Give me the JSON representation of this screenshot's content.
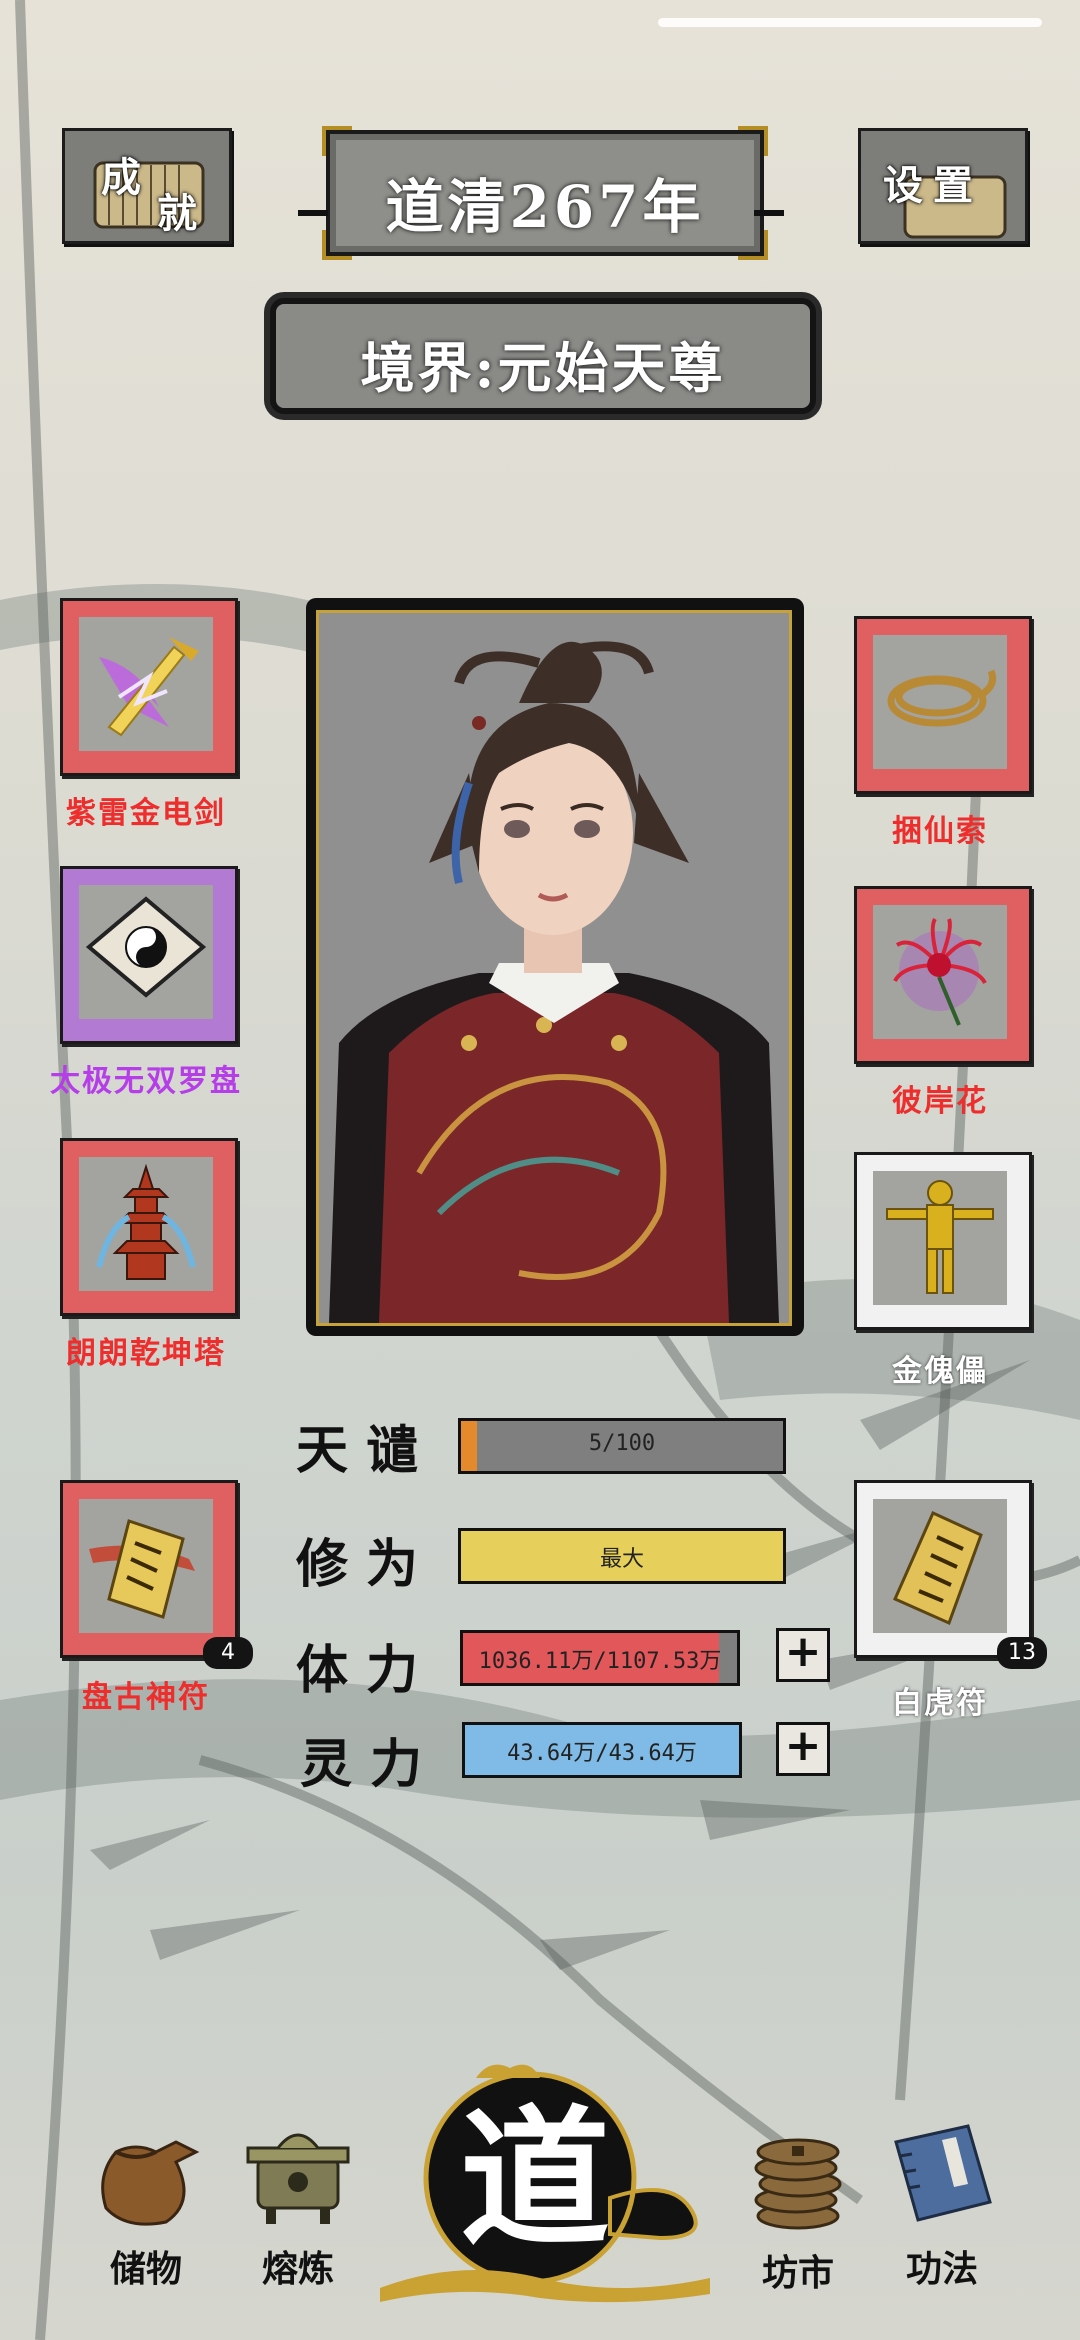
{
  "header": {
    "achievements_label": [
      "成",
      "就"
    ],
    "year_title": "道清267年",
    "settings_label": "设置",
    "realm": "境界:元始天尊"
  },
  "left_items": [
    {
      "name": "紫雷金电剑",
      "frame": "red",
      "icon": "lightning-sword-icon"
    },
    {
      "name": "太极无双罗盘",
      "frame": "purple",
      "icon": "taiji-compass-icon"
    },
    {
      "name": "朗朗乾坤塔",
      "frame": "red",
      "icon": "pagoda-icon"
    },
    {
      "name": "盘古神符",
      "frame": "red",
      "icon": "talisman-icon",
      "count": "4"
    }
  ],
  "right_items": [
    {
      "name": "捆仙索",
      "frame": "red",
      "icon": "rope-icon"
    },
    {
      "name": "彼岸花",
      "frame": "red",
      "icon": "spider-lily-icon"
    },
    {
      "name": "金傀儡",
      "frame": "white",
      "icon": "golden-puppet-icon"
    },
    {
      "name": "白虎符",
      "frame": "white",
      "icon": "talisman-icon",
      "count": "13"
    }
  ],
  "stats": {
    "tribulation": {
      "label": "天谴",
      "value": "5/100",
      "progress": 0.05,
      "color": "#e58a2c"
    },
    "cultivation": {
      "label": "修为",
      "value": "最大",
      "progress": 1.0,
      "color": "#e6cf5a"
    },
    "stamina": {
      "label": "体力",
      "value": "1036.11万/1107.53万",
      "progress": 0.935,
      "color": "#e2575a"
    },
    "spirit": {
      "label": "灵力",
      "value": "43.64万/43.64万",
      "progress": 1.0,
      "color": "#7fbbe6"
    },
    "plus_symbol": "+"
  },
  "nav": {
    "storage": "储物",
    "smelting": "熔炼",
    "dao": "道",
    "market": "坊市",
    "techniques": "功法"
  }
}
